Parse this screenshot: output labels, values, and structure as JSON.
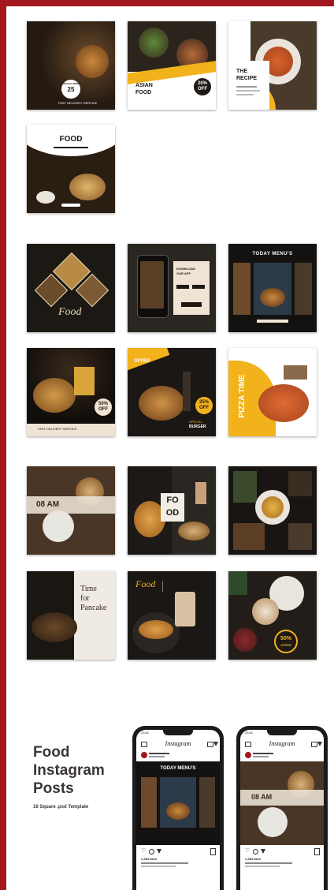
{
  "colors": {
    "frame": "#a3171d",
    "accent": "#f2b21b",
    "dark": "#1e1915",
    "cream": "#efe3d3"
  },
  "row1": {
    "badge_price": "25",
    "badge_small": "SPECIAL MENU",
    "delivery": "FAST DELIVERY SERVICE",
    "asian_title_1": "ASIAN",
    "asian_title_2": "FOOD",
    "asian_badge_1": "20%",
    "asian_badge_2": "OFF",
    "recipe_title_1": "THE",
    "recipe_title_2": "RECIPE"
  },
  "row2": {
    "food_title": "FOOD"
  },
  "row3": {
    "food_script": "Food",
    "download_1": "DOWNLOAD",
    "download_2": "OUR APP",
    "today_menu": "TODAY MENU'S"
  },
  "row4": {
    "burger_badge_1": "50%",
    "burger_badge_2": "OFF",
    "delivery": "FAST DELIVERY SERVICE",
    "weekend_1": "WEEKEND",
    "weekend_2": "OFFER",
    "weekend_badge_1": "25%",
    "weekend_badge_2": "OFF",
    "special_1": "SPECIAL",
    "special_2": "BURGER",
    "pizza_time": "PIZZA TIME"
  },
  "row5": {
    "time_label": "08 AM",
    "fo": "FO",
    "od": "OD"
  },
  "row6": {
    "pancake_1": "Time",
    "pancake_2": "for",
    "pancake_3": "Pancake",
    "food_script": "Food",
    "coffee_badge_1": "50%",
    "coffee_badge_2": "OFFER"
  },
  "promo": {
    "title_1": "Food",
    "title_2": "Instagram",
    "title_3": "Posts",
    "subtitle": "16 Square .psd Template"
  },
  "phones": [
    {
      "time": "20:41",
      "app": "Instagram",
      "post_banner": "TODAY MENU'S",
      "likes": "1,283 likes"
    },
    {
      "time": "20:41",
      "app": "Instagram",
      "post_banner": "08 AM",
      "likes": "1,283 likes"
    }
  ]
}
